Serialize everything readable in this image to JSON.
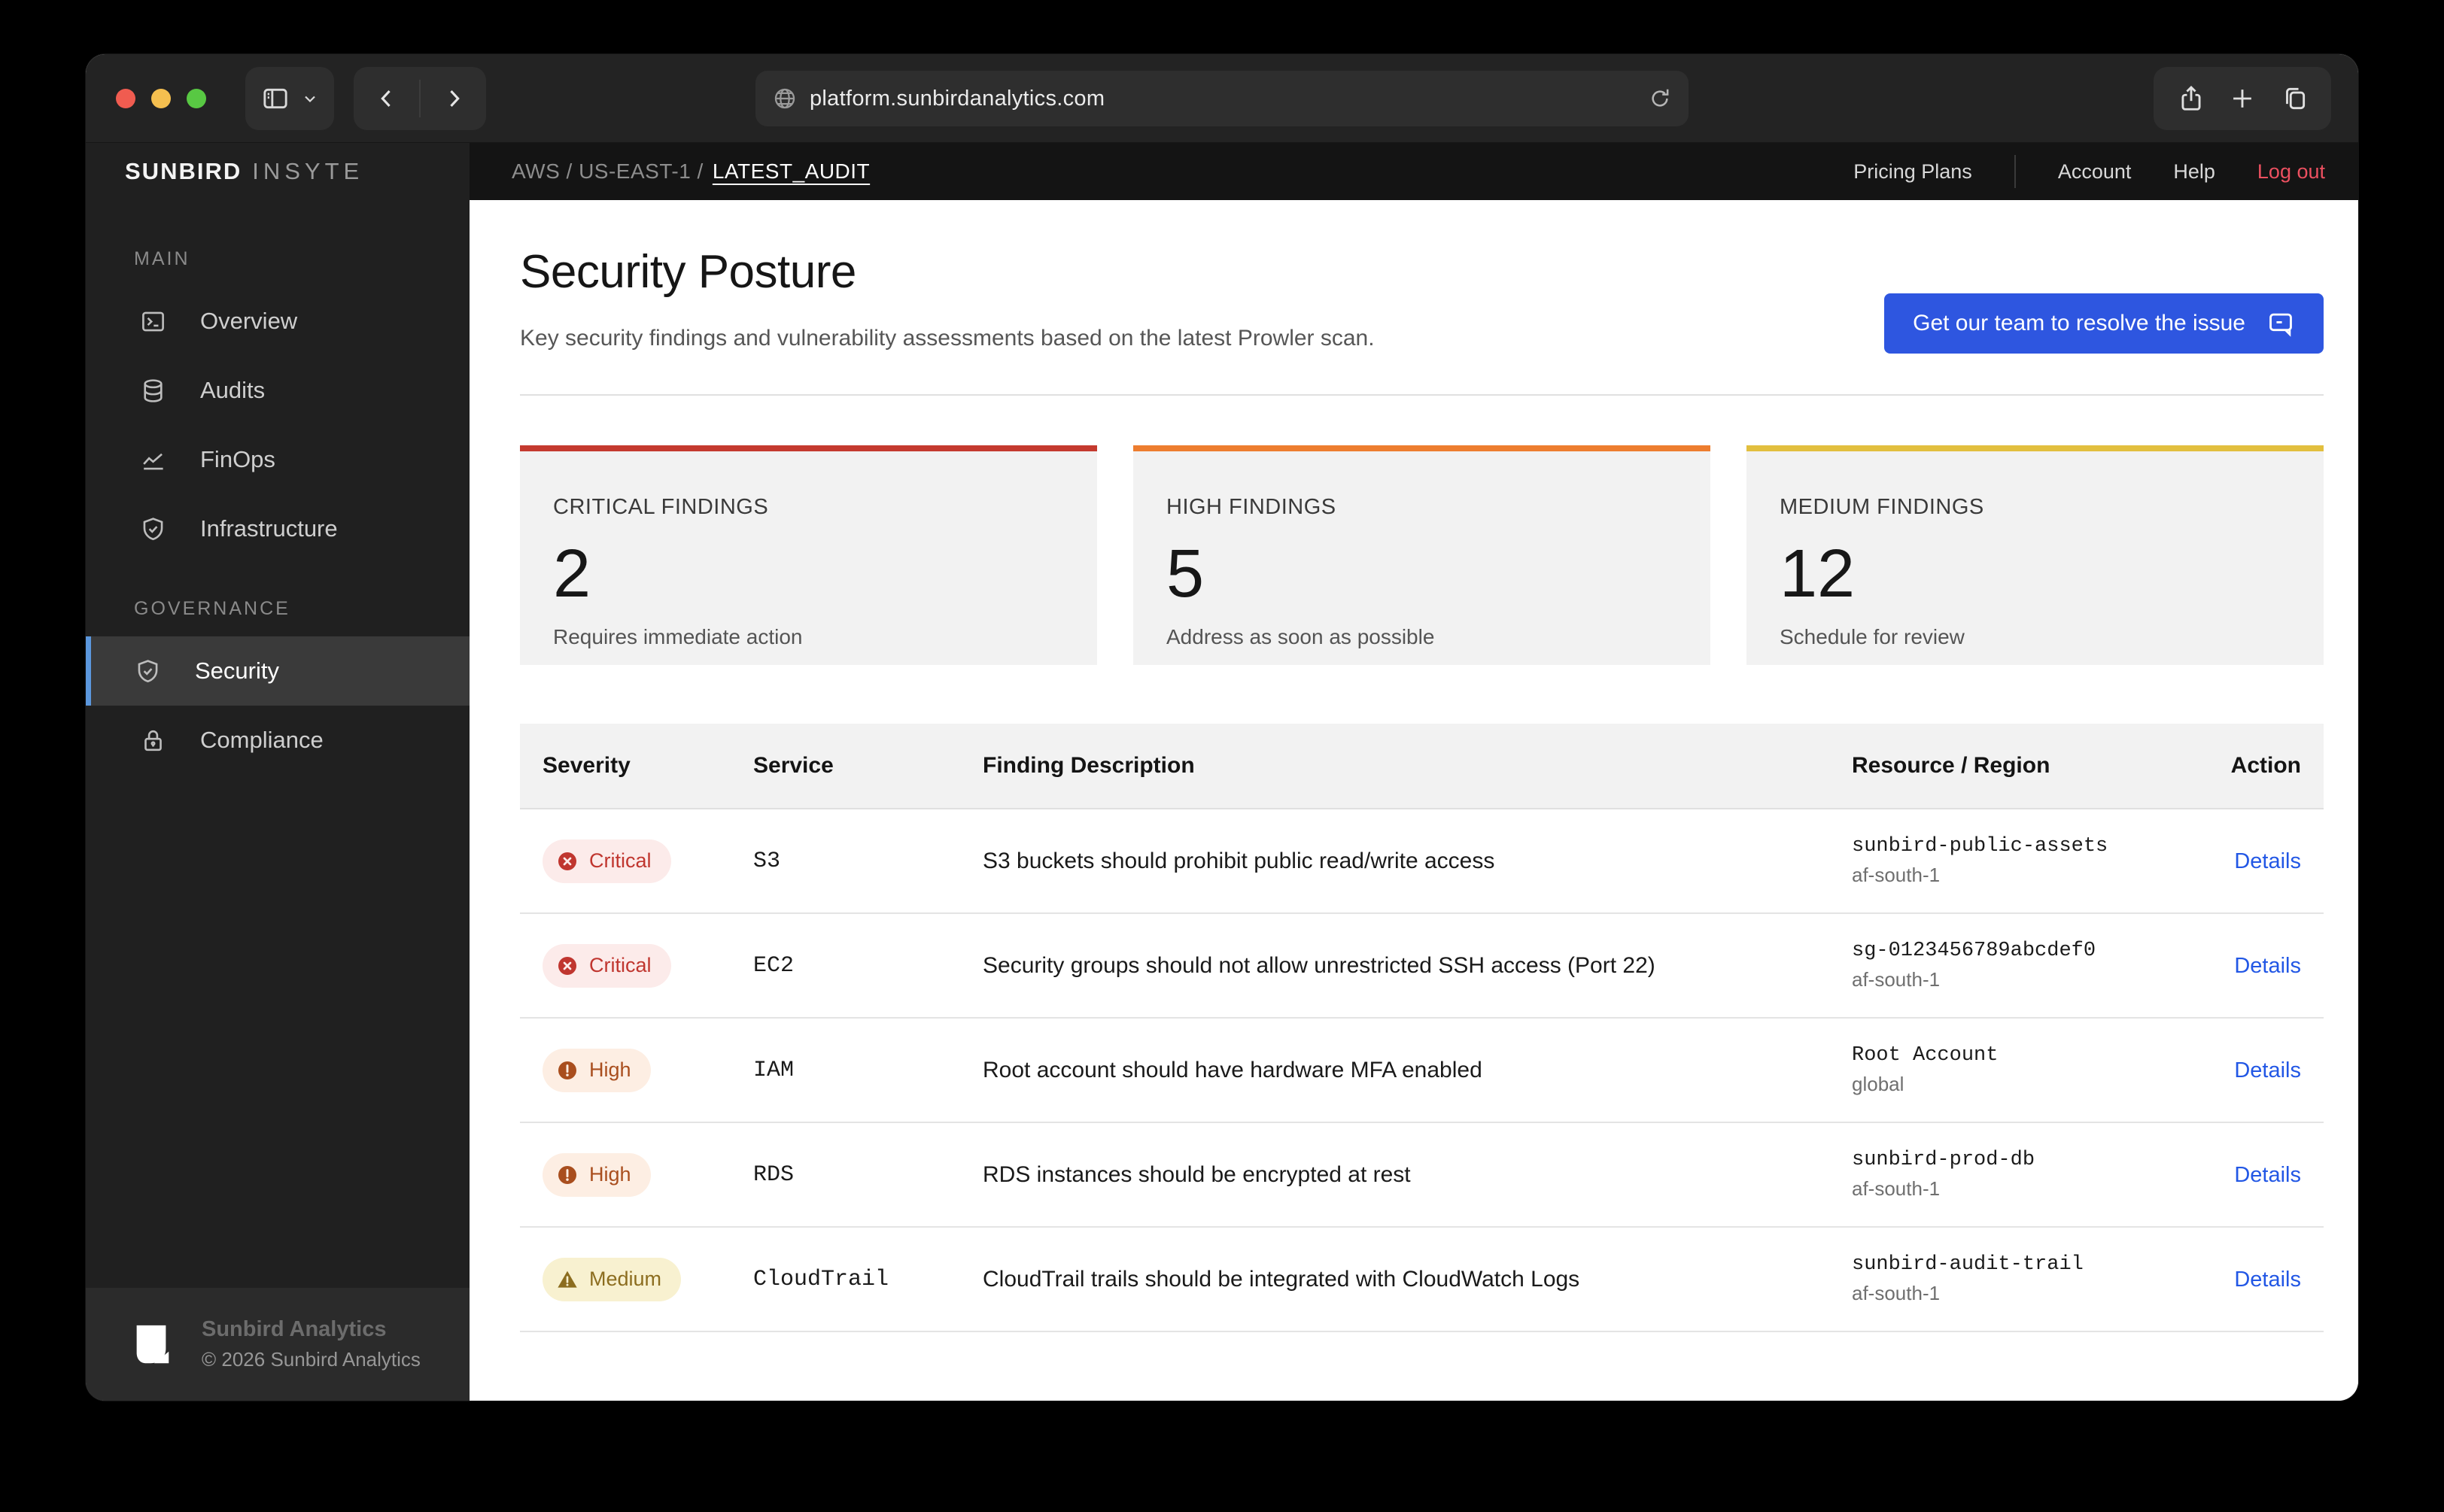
{
  "browser": {
    "url": "platform.sunbirdanalytics.com"
  },
  "topnav": {
    "breadcrumb_prefix": "AWS / US-EAST-1 /",
    "breadcrumb_current": "LATEST_AUDIT",
    "links": {
      "pricing": "Pricing Plans",
      "account": "Account",
      "help": "Help",
      "logout": "Log out"
    }
  },
  "sidebar": {
    "brand_bold": "SUNBIRD",
    "brand_light": "INSYTE",
    "sections": [
      {
        "label": "MAIN",
        "items": [
          {
            "label": "Overview",
            "icon": "terminal-icon"
          },
          {
            "label": "Audits",
            "icon": "database-icon"
          },
          {
            "label": "FinOps",
            "icon": "chart-line-icon"
          },
          {
            "label": "Infrastructure",
            "icon": "shield-check-icon"
          }
        ]
      },
      {
        "label": "GOVERNANCE",
        "items": [
          {
            "label": "Security",
            "icon": "shield-check-icon",
            "active": true
          },
          {
            "label": "Compliance",
            "icon": "lock-icon"
          }
        ]
      }
    ],
    "footer": {
      "name": "Sunbird Analytics",
      "copyright": "© 2026 Sunbird Analytics"
    }
  },
  "page": {
    "title": "Security Posture",
    "subtitle": "Key security findings and vulnerability assessments based on the latest Prowler scan.",
    "cta_label": "Get our team to resolve the issue"
  },
  "summary_cards": [
    {
      "label": "CRITICAL FINDINGS",
      "value": "2",
      "description": "Requires immediate action",
      "accent": "#c43a2f"
    },
    {
      "label": "HIGH FINDINGS",
      "value": "5",
      "description": "Address as soon as possible",
      "accent": "#ed7d2f"
    },
    {
      "label": "MEDIUM FINDINGS",
      "value": "12",
      "description": "Schedule for review",
      "accent": "#e2bf3e"
    }
  ],
  "table": {
    "columns": [
      "Severity",
      "Service",
      "Finding Description",
      "Resource / Region",
      "Action"
    ],
    "rows": [
      {
        "severity": "Critical",
        "service": "S3",
        "description": "S3 buckets should prohibit public read/write access",
        "resource": "sunbird-public-assets",
        "region": "af-south-1",
        "action": "Details"
      },
      {
        "severity": "Critical",
        "service": "EC2",
        "description": "Security groups should not allow unrestricted SSH access (Port 22)",
        "resource": "sg-0123456789abcdef0",
        "region": "af-south-1",
        "action": "Details"
      },
      {
        "severity": "High",
        "service": "IAM",
        "description": "Root account should have hardware MFA enabled",
        "resource": "Root Account",
        "region": "global",
        "action": "Details"
      },
      {
        "severity": "High",
        "service": "RDS",
        "description": "RDS instances should be encrypted at rest",
        "resource": "sunbird-prod-db",
        "region": "af-south-1",
        "action": "Details"
      },
      {
        "severity": "Medium",
        "service": "CloudTrail",
        "description": "CloudTrail trails should be integrated with CloudWatch Logs",
        "resource": "sunbird-audit-trail",
        "region": "af-south-1",
        "action": "Details"
      }
    ]
  },
  "colors": {
    "accent_blue": "#2e56e0",
    "link_blue": "#2257e5",
    "active_nav_blue": "#5b97dd",
    "logout_red": "#ec5060",
    "critical_red": "#c0362f",
    "high_orange": "#a94e1e",
    "medium_yellow": "#8c6d1f"
  }
}
